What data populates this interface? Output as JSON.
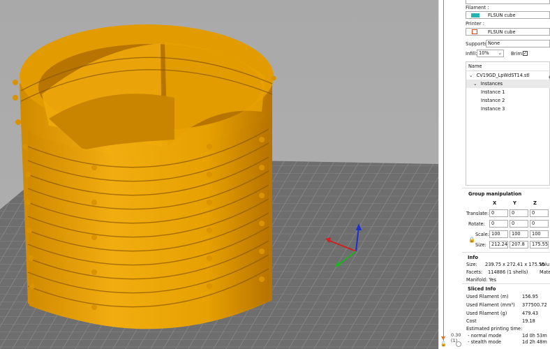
{
  "colors": {
    "accent": "#ed6b21",
    "model": "#f0a800",
    "filament_swatch": "#26b3b3",
    "bed": "#6e6e6e",
    "background": "#aaaaaa"
  },
  "filament": {
    "label": "Filament :",
    "value": "FLSUN cube"
  },
  "printer": {
    "label": "Printer :",
    "value": "FLSUN cube"
  },
  "supports": {
    "label": "Supports:",
    "value": "None"
  },
  "infill": {
    "label": "Infill:",
    "value": "10%"
  },
  "brim": {
    "label": "Brim:",
    "checked": true,
    "check_mark": "✓"
  },
  "object_list": {
    "header": "Name",
    "object": "CV19GD_LpWdST14.stl",
    "group": "Instances",
    "instances": [
      "Instance 1",
      "Instance 2",
      "Instance 3"
    ],
    "eye_icon": "eye-icon"
  },
  "group_manipulation": {
    "title": "Group manipulation",
    "columns": [
      "X",
      "Y",
      "Z"
    ],
    "rows": [
      {
        "label": "Translate:",
        "values": [
          "0",
          "0",
          "0"
        ]
      },
      {
        "label": "Rotate:",
        "values": [
          "0",
          "0",
          "0"
        ]
      },
      {
        "label": "Scale:",
        "values": [
          "100",
          "100",
          "100"
        ]
      },
      {
        "label": "Size:",
        "values": [
          "212.24",
          "207.8",
          "175.55"
        ]
      }
    ]
  },
  "info": {
    "title": "Info",
    "size_label": "Size:",
    "size_value": "239.75 x 272.41 x 175.55",
    "volume_label": "Volu",
    "facets_label": "Facets:",
    "facets_value": "114886 (1 shells)",
    "materials_label": "Mate",
    "manifold": "Manifold: Yes"
  },
  "sliced_info": {
    "title": "Sliced Info",
    "rows": [
      {
        "label": "Used Filament (m)",
        "value": "156.95"
      },
      {
        "label": "Used Filament (mm³)",
        "value": "377500.72"
      },
      {
        "label": "Used Filament (g)",
        "value": "479.43"
      },
      {
        "label": "Cost",
        "value": "19.18"
      }
    ],
    "time_label": "Estimated printing time:",
    "normal_label": " - normal mode",
    "normal_value": "1d 0h 53m",
    "stealth_label": " - stealth mode",
    "stealth_value": "1d 2h 48m"
  },
  "layer_slider": {
    "value": "0.30",
    "layer": "(1)"
  }
}
